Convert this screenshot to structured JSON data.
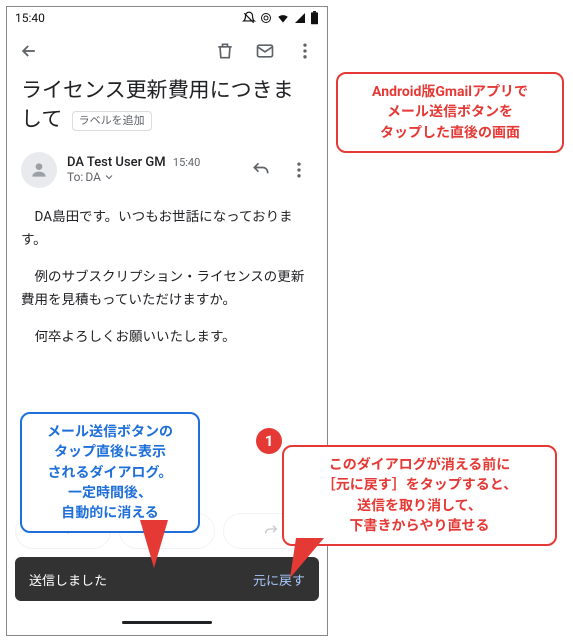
{
  "statusbar": {
    "time": "15:40"
  },
  "subject": "ライセンス更新費用につきまして",
  "add_label": "ラベルを追加",
  "sender": {
    "name": "DA Test User GM",
    "time": "15:40",
    "to_prefix": "To:",
    "to": "DA"
  },
  "body": {
    "p1": "DA島田です。いつもお世話になっております。",
    "p2": "例のサブスクリプション・ライセンスの更新費用を見積もっていただけますか。",
    "p3": "何卒よろしくお願いいたします。"
  },
  "snackbar": {
    "text": "送信しました",
    "action": "元に戻す"
  },
  "callouts": {
    "top": "Android版Gmailアプリで\nメール送信ボタンを\nタップした直後の画面",
    "left": "メール送信ボタンの\nタップ直後に表示\nされるダイアログ。\n一定時間後、\n自動的に消える",
    "right": "このダイアログが消える前に\n［元に戻す］をタップすると、\n送信を取り消して、\n下書きからやり直せる"
  },
  "badge": "1"
}
